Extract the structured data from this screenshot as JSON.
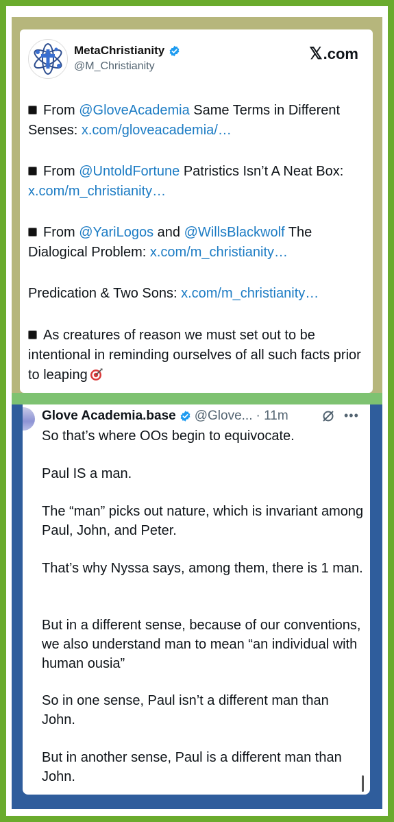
{
  "top_tweet": {
    "author_name": "MetaChristianity",
    "handle": "@M_Christianity",
    "source": "x.com",
    "lines": [
      {
        "bullet": true,
        "parts": [
          {
            "t": "From ",
            "link": false
          },
          {
            "t": "@GloveAcademia",
            "link": true
          },
          {
            "t": " Same Terms in Different Senses: ",
            "link": false
          },
          {
            "t": "x.com/gloveacademia/…",
            "link": true
          }
        ]
      },
      {
        "bullet": true,
        "parts": [
          {
            "t": "From ",
            "link": false
          },
          {
            "t": "@UntoldFortune",
            "link": true
          },
          {
            "t": " Patristics Isn’t A Neat Box: ",
            "link": false
          },
          {
            "t": "x.com/m_christianity…",
            "link": true
          }
        ]
      },
      {
        "bullet": true,
        "parts": [
          {
            "t": "From ",
            "link": false
          },
          {
            "t": "@YariLogos",
            "link": true
          },
          {
            "t": " and ",
            "link": false
          },
          {
            "t": "@WillsBlackwolf",
            "link": true
          },
          {
            "t": " The Dialogical Problem: ",
            "link": false
          },
          {
            "t": "x.com/m_christianity…",
            "link": true
          }
        ]
      },
      {
        "bullet": false,
        "parts": [
          {
            "t": "Predication & Two Sons: ",
            "link": false
          },
          {
            "t": "x.com/m_christianity…",
            "link": true
          }
        ]
      },
      {
        "bullet": true,
        "parts": [
          {
            "t": "As creatures of reason we must set out to be intentional in reminding ourselves of all such facts prior to leaping",
            "link": false
          }
        ],
        "emoji": "target-icon"
      }
    ]
  },
  "bottom_tweet": {
    "author_name": "Glove Academia.base",
    "handle": "@Glove...",
    "time": "· 11m",
    "paragraphs": [
      "So that’s where OOs begin to equivocate.",
      "Paul IS a man.",
      "The “man” picks out nature, which is invariant among Paul, John, and Peter.",
      "That’s why Nyssa says, among them, there is 1 man.",
      "But in a different sense, because of our conventions, we also understand man to mean “an individual with human ousia”",
      "So in one sense, Paul isn’t a different man than John.",
      "But in another sense, Paul is a different man than John."
    ]
  },
  "colors": {
    "outer_frame": "#6aab2d",
    "top_band": "#b6b67c",
    "divider": "#7ec271",
    "bottom_band": "#2f5d9c",
    "link": "#1d7cc4",
    "verified": "#1d9bf0"
  }
}
